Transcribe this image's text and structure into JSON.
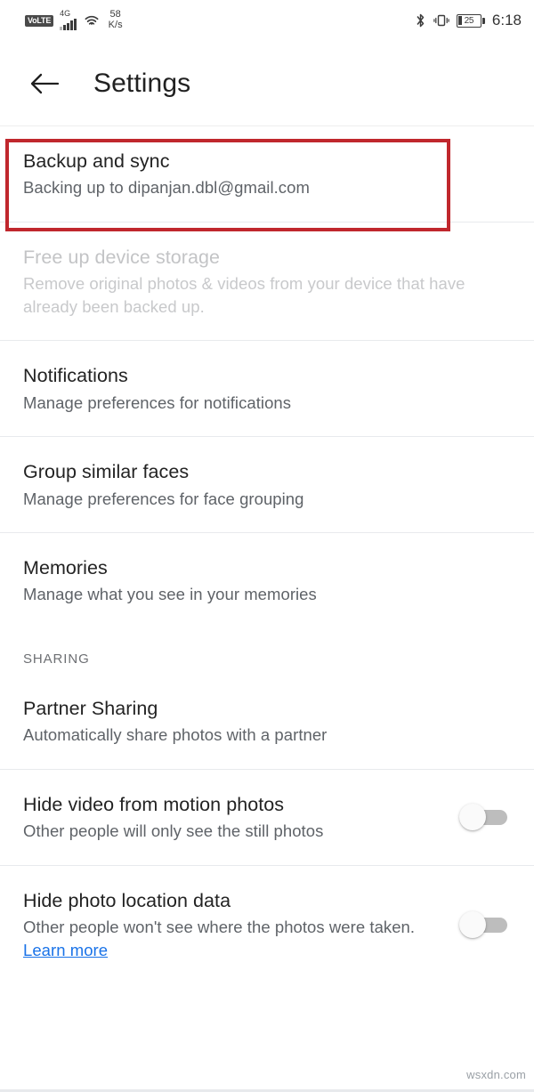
{
  "status_bar": {
    "volte_label": "VoLTE",
    "network_type": "4G",
    "signal_bars": 5,
    "wifi_icon": "wifi-icon",
    "data_speed_value": "58",
    "data_speed_unit": "K/s",
    "bluetooth_icon": "bluetooth-icon",
    "vibrate_icon": "vibrate-icon",
    "battery_percent": "25",
    "time": "6:18"
  },
  "app_bar": {
    "back_icon": "back-arrow-icon",
    "title": "Settings"
  },
  "highlight": {
    "color": "#c0272d",
    "target": "backup-and-sync"
  },
  "settings": {
    "items": [
      {
        "id": "backup-and-sync",
        "title": "Backup and sync",
        "subtitle": "Backing up to dipanjan.dbl@gmail.com",
        "disabled": false,
        "toggle": null,
        "highlighted": true
      },
      {
        "id": "free-up-device-storage",
        "title": "Free up device storage",
        "subtitle": "Remove original photos & videos from your device that have already been backed up.",
        "disabled": true,
        "toggle": null,
        "highlighted": false
      },
      {
        "id": "notifications",
        "title": "Notifications",
        "subtitle": "Manage preferences for notifications",
        "disabled": false,
        "toggle": null,
        "highlighted": false
      },
      {
        "id": "group-similar-faces",
        "title": "Group similar faces",
        "subtitle": "Manage preferences for face grouping",
        "disabled": false,
        "toggle": null,
        "highlighted": false
      },
      {
        "id": "memories",
        "title": "Memories",
        "subtitle": "Manage what you see in your memories",
        "disabled": false,
        "toggle": null,
        "highlighted": false
      }
    ],
    "sharing_section": {
      "header": "SHARING",
      "items": [
        {
          "id": "partner-sharing",
          "title": "Partner Sharing",
          "subtitle": "Automatically share photos with a partner",
          "toggle": null
        },
        {
          "id": "hide-video-from-motion-photos",
          "title": "Hide video from motion photos",
          "subtitle": "Other people will only see the still photos",
          "toggle": "off"
        },
        {
          "id": "hide-photo-location-data",
          "title": "Hide photo location data",
          "subtitle": "Other people won't see where the photos were taken. ",
          "link_text": "Learn more",
          "toggle": "off"
        }
      ]
    }
  },
  "watermark": "wsxdn.com"
}
